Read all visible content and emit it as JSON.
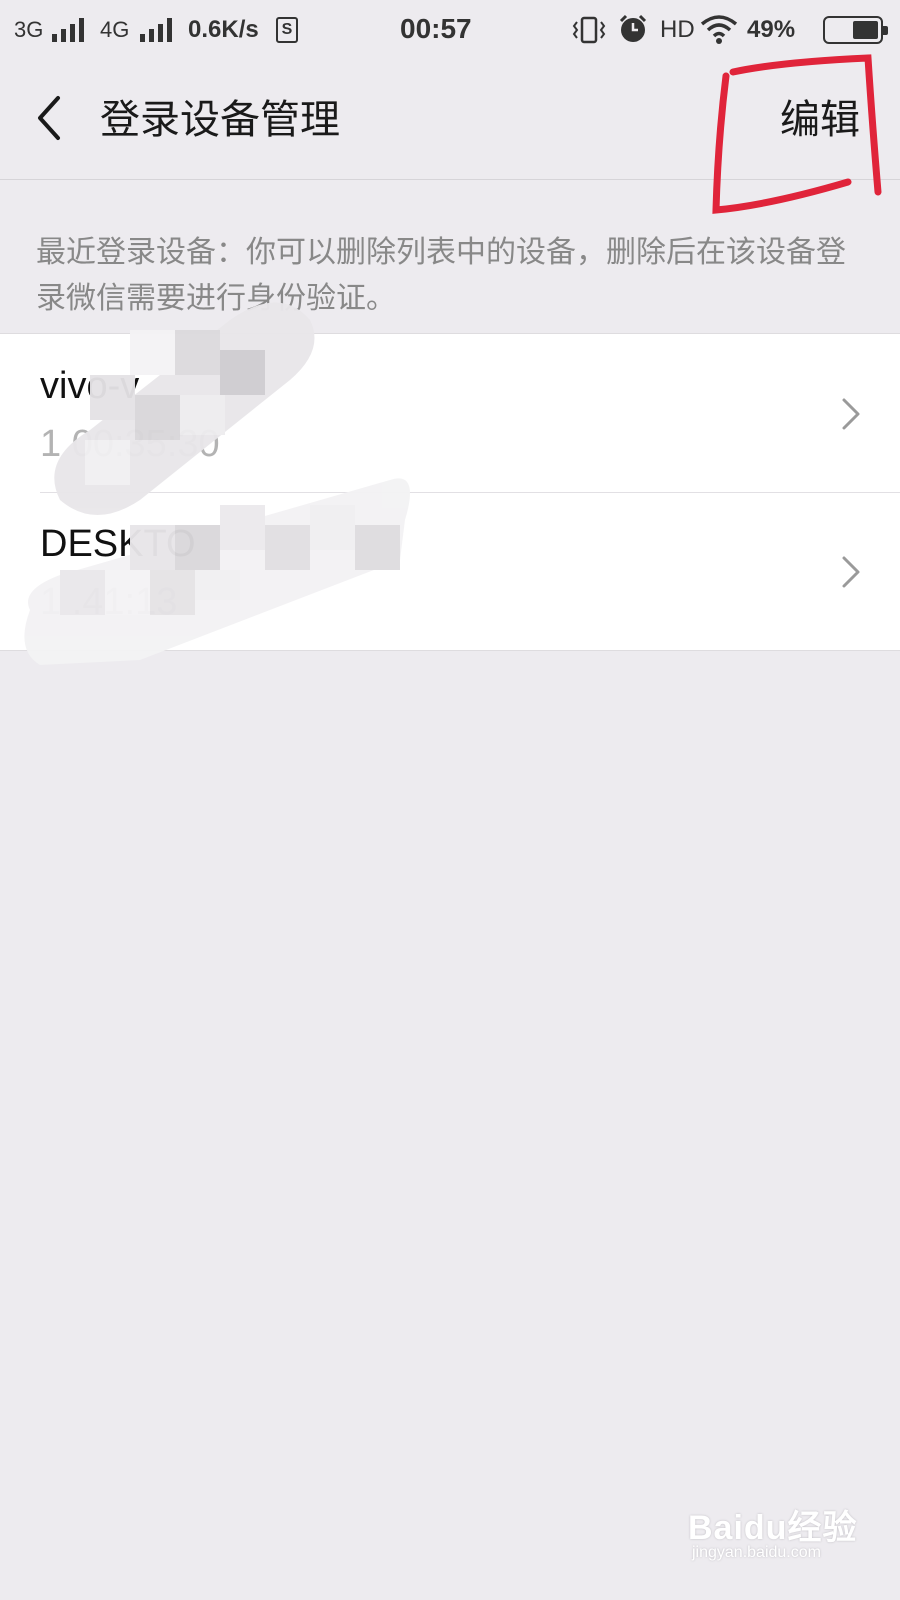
{
  "status_bar": {
    "net1": "3G",
    "net2": "4G",
    "speed": "0.6K/s",
    "sim_badge": "S",
    "time": "00:57",
    "hd": "HD",
    "battery": "49%",
    "battery_level": 0.49,
    "icons": [
      "signal-icon",
      "vibrate-icon",
      "alarm-icon",
      "wifi-icon",
      "battery-icon"
    ]
  },
  "header": {
    "back_icon": "chevron-left-icon",
    "title": "登录设备管理",
    "edit_label": "编辑"
  },
  "hint": "最近登录设备：你可以删除列表中的设备，删除后在该设备登录微信需要进行身份验证。",
  "devices": [
    {
      "name": "vivo-v",
      "time": "1        00:35:30"
    },
    {
      "name": "DESKTO",
      "time": "1        .41:13"
    }
  ],
  "watermark": {
    "brand": "Baidu经验",
    "url": "jingyan.baidu.com"
  },
  "colors": {
    "background": "#edebef",
    "list_background": "#ffffff",
    "annotation": "#e0243a"
  }
}
